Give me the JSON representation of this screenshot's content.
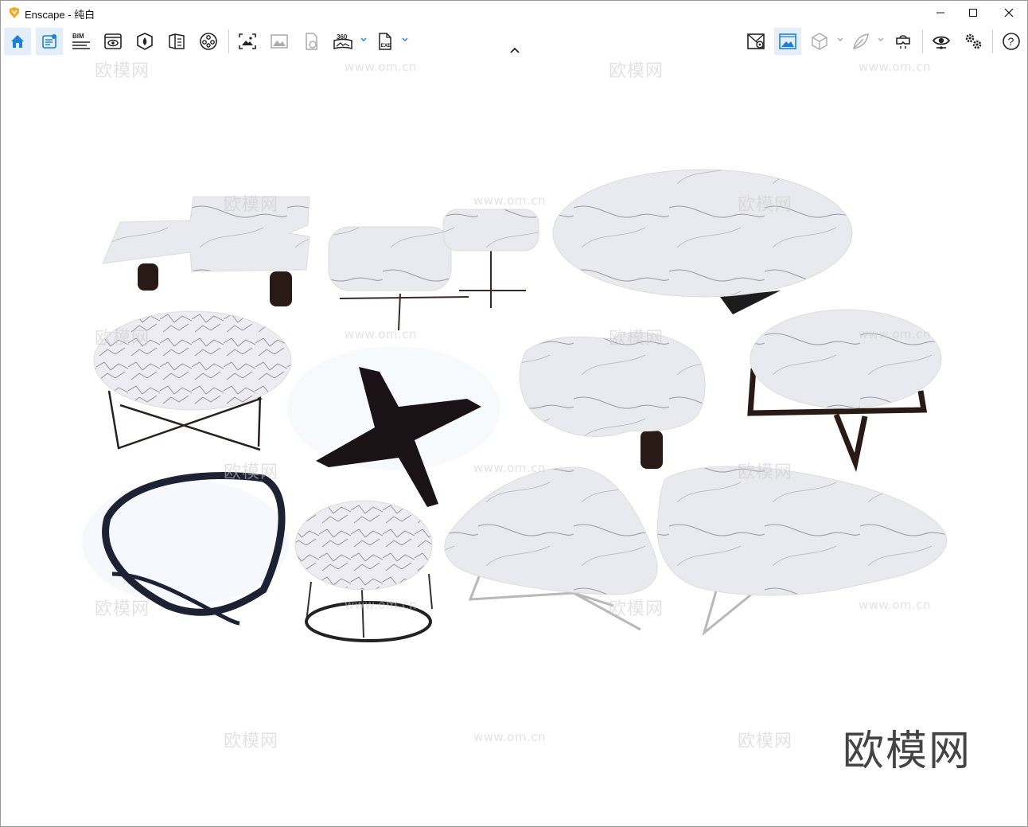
{
  "window": {
    "app_name": "Enscape",
    "separator": " - ",
    "scene_name": "纯白",
    "brand_color": "#f5a623"
  },
  "window_controls": [
    "minimize-icon",
    "maximize-icon",
    "close-icon"
  ],
  "toolbar": {
    "left_tools": [
      {
        "icon": "home-icon",
        "active": true
      },
      {
        "icon": "view-management-icon",
        "active": true
      },
      {
        "icon": "bim-icon",
        "label": "BIM"
      },
      {
        "icon": "visual-settings-icon"
      },
      {
        "icon": "asset-library-icon"
      },
      {
        "icon": "material-editor-icon"
      },
      {
        "icon": "video-editor-icon"
      },
      {
        "icon": "screenshot-icon"
      },
      {
        "icon": "batch-render-icon"
      },
      {
        "icon": "web-standalone-icon"
      },
      {
        "icon": "panorama-icon",
        "label": "360"
      },
      {
        "icon": "export-exe-icon",
        "label": "EXE"
      }
    ],
    "right_tools": [
      {
        "icon": "sync-views-icon"
      },
      {
        "icon": "capture-view-icon",
        "active": true
      },
      {
        "icon": "box-view-icon"
      },
      {
        "icon": "leaf-icon"
      },
      {
        "icon": "vr-headset-icon"
      },
      {
        "icon": "eye-icon"
      },
      {
        "icon": "settings-gears-icon"
      },
      {
        "icon": "help-icon",
        "label": "?"
      }
    ],
    "accent_color": "#1e7fd6"
  },
  "watermark": {
    "site": "www.om.cn",
    "cn": "欧模网",
    "brand": "欧模网"
  }
}
